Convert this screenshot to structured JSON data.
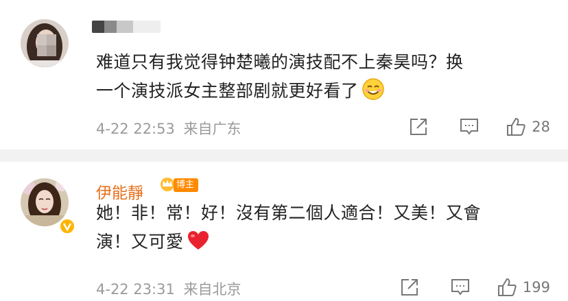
{
  "comments": [
    {
      "username": "",
      "text_line1": "难道只有我觉得钟楚曦的演技配不上秦昊吗？换",
      "text_line2": "一个演技派女主整部剧就更好看了",
      "date": "4-22 22:53",
      "location": "来自广东",
      "likes": "28",
      "emoji": "smile-emoji"
    },
    {
      "username": "伊能靜",
      "badge": "博主",
      "text_line1": "她！非！常！好！沒有第二個人適合！又美！又會",
      "text_line2": "演！又可愛",
      "date": "4-22 23:31",
      "location": "来自北京",
      "likes": "199",
      "emoji": "red-heart-emoji"
    }
  ],
  "colors": {
    "username": "#e86f1a",
    "badge": "#ff8a00",
    "meta": "#9a9a9a",
    "separator": "#f2f2f2",
    "heart": "#e8232f"
  },
  "icons": [
    "share-icon",
    "comment-icon",
    "like-icon",
    "verified-v-icon",
    "crown-icon"
  ]
}
